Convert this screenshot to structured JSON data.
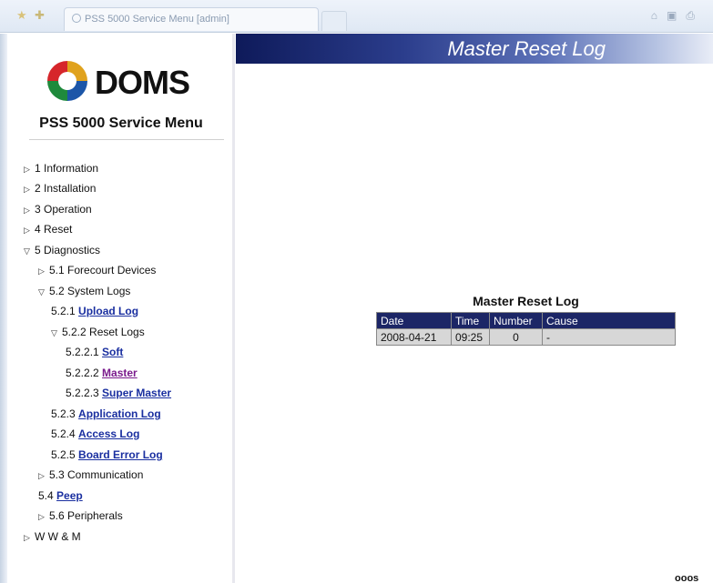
{
  "browser": {
    "tab_title": "PSS 5000 Service Menu [admin]"
  },
  "sidebar": {
    "logo_text": "DOMS",
    "menu_title": "PSS 5000 Service Menu",
    "items": [
      {
        "label": "1 Information",
        "state": "collapsed"
      },
      {
        "label": "2 Installation",
        "state": "collapsed"
      },
      {
        "label": "3 Operation",
        "state": "collapsed"
      },
      {
        "label": "4 Reset",
        "state": "collapsed"
      },
      {
        "label": "5 Diagnostics",
        "state": "expanded"
      },
      {
        "label": "5.1 Forecourt Devices",
        "state": "collapsed"
      },
      {
        "label": "5.2 System Logs",
        "state": "expanded"
      },
      {
        "prefix": "5.2.1",
        "link": "Upload Log"
      },
      {
        "label": "5.2.2 Reset Logs",
        "state": "expanded"
      },
      {
        "prefix": "5.2.2.1",
        "link": "Soft"
      },
      {
        "prefix": "5.2.2.2",
        "link": "Master"
      },
      {
        "prefix": "5.2.2.3",
        "link": "Super Master"
      },
      {
        "prefix": "5.2.3",
        "link": "Application Log"
      },
      {
        "prefix": "5.2.4",
        "link": "Access Log"
      },
      {
        "prefix": "5.2.5",
        "link": "Board Error Log"
      },
      {
        "label": "5.3 Communication",
        "state": "collapsed"
      },
      {
        "prefix": "5.4",
        "link": "Peep"
      },
      {
        "label": "5.6 Peripherals",
        "state": "collapsed"
      },
      {
        "label": "W W & M",
        "state": "collapsed"
      }
    ]
  },
  "main": {
    "header_title": "Master Reset Log",
    "log": {
      "caption": "Master Reset Log",
      "columns": [
        "Date",
        "Time",
        "Number",
        "Cause"
      ],
      "rows": [
        [
          "2008-04-21",
          "09:25",
          "0",
          "-"
        ]
      ]
    },
    "footer_partial": "ooos"
  },
  "colors": {
    "header_dark": "#0e1a5a",
    "link": "#1a2fa0",
    "visited_link": "#7a1a8c",
    "table_header": "#1c2666",
    "table_cell": "#d7d7d7"
  }
}
